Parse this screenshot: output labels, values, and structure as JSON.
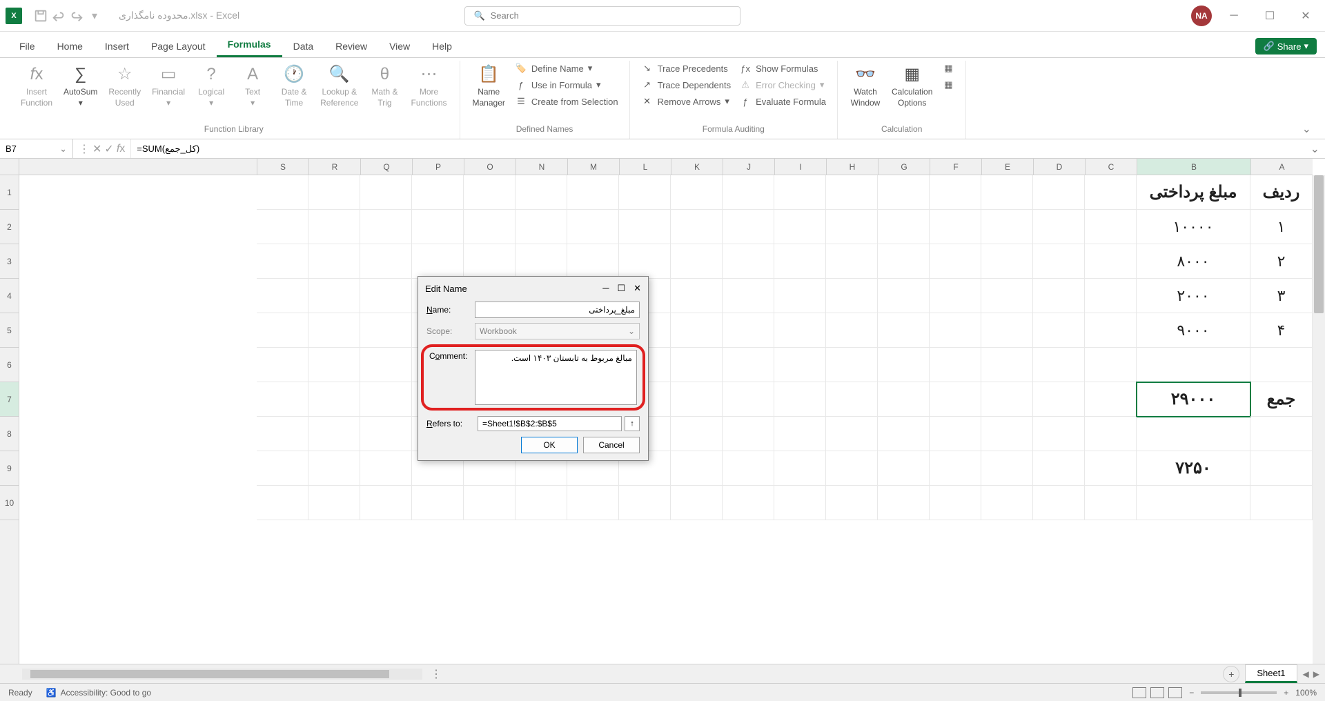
{
  "title_bar": {
    "file_name": "محدوده نامگذاری.xlsx - Excel",
    "search_placeholder": "Search",
    "avatar": "NA"
  },
  "tabs": {
    "items": [
      "File",
      "Home",
      "Insert",
      "Page Layout",
      "Formulas",
      "Data",
      "Review",
      "View",
      "Help"
    ],
    "active": "Formulas",
    "share": "Share"
  },
  "ribbon": {
    "func_lib": {
      "insert_function": "Insert\nFunction",
      "autosum": "AutoSum",
      "recently_used": "Recently\nUsed",
      "financial": "Financial",
      "logical": "Logical",
      "text": "Text",
      "date_time": "Date &\nTime",
      "lookup": "Lookup &\nReference",
      "math": "Math &\nTrig",
      "more": "More\nFunctions",
      "label": "Function Library"
    },
    "defined": {
      "name_manager": "Name\nManager",
      "define_name": "Define Name",
      "use_in_formula": "Use in Formula",
      "create_from_selection": "Create from Selection",
      "label": "Defined Names"
    },
    "auditing": {
      "trace_precedents": "Trace Precedents",
      "trace_dependents": "Trace Dependents",
      "remove_arrows": "Remove Arrows",
      "show_formulas": "Show Formulas",
      "error_checking": "Error Checking",
      "evaluate": "Evaluate Formula",
      "label": "Formula Auditing"
    },
    "calc": {
      "watch_window": "Watch\nWindow",
      "calc_options": "Calculation\nOptions",
      "label": "Calculation"
    }
  },
  "formula_bar": {
    "name_box": "B7",
    "formula": "=SUM(کل_جمع)"
  },
  "columns": [
    "A",
    "B",
    "C",
    "D",
    "E",
    "F",
    "G",
    "H",
    "I",
    "J",
    "K",
    "L",
    "M",
    "N",
    "O",
    "P",
    "Q",
    "R",
    "S"
  ],
  "rows": [
    "1",
    "2",
    "3",
    "4",
    "5",
    "6",
    "7",
    "8",
    "9",
    "10"
  ],
  "cells": {
    "A1": "ردیف",
    "B1": "مبلغ پرداختی",
    "A2": "۱",
    "B2": "۱۰۰۰۰",
    "A3": "۲",
    "B3": "۸۰۰۰",
    "A4": "۳",
    "B4": "۲۰۰۰",
    "A5": "۴",
    "B5": "۹۰۰۰",
    "A7": "جمع",
    "B7": "۲۹۰۰۰",
    "B9": "۷۲۵۰"
  },
  "dialog": {
    "title": "Edit Name",
    "name_label": "Name:",
    "name_value": "مبلغ_پرداختی",
    "scope_label": "Scope:",
    "scope_value": "Workbook",
    "comment_label": "Comment:",
    "comment_value": "مبالغ مربوط به تابستان ۱۴۰۳ است.",
    "refers_label": "Refers to:",
    "refers_value": "=Sheet1!$B$2:$B$5",
    "ok": "OK",
    "cancel": "Cancel"
  },
  "sheet_tabs": {
    "sheet1": "Sheet1"
  },
  "status": {
    "ready": "Ready",
    "accessibility": "Accessibility: Good to go",
    "zoom": "100%"
  }
}
